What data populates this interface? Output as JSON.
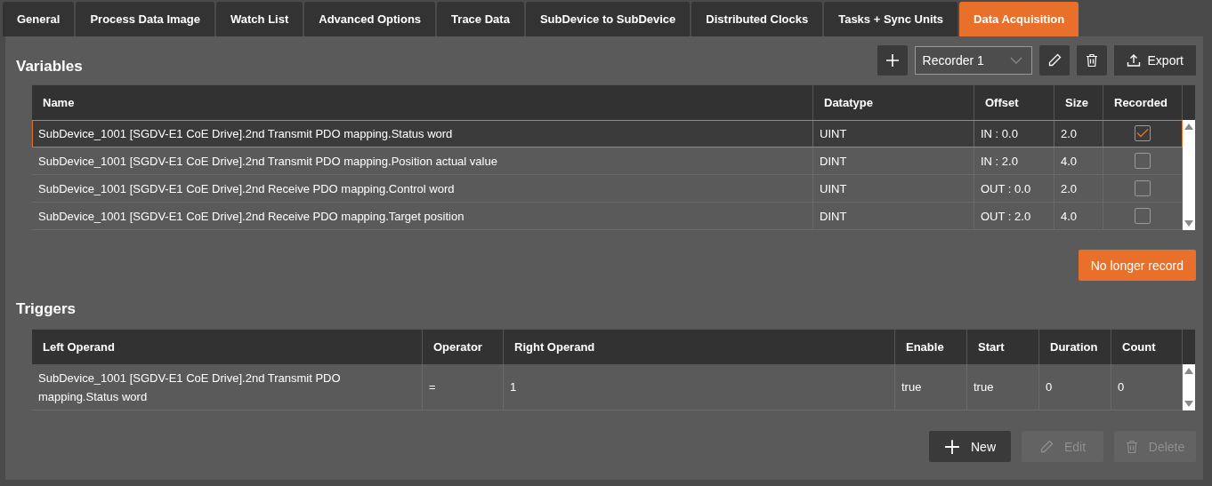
{
  "tabs": [
    {
      "label": "General",
      "selected": false
    },
    {
      "label": "Process Data Image",
      "selected": false
    },
    {
      "label": "Watch List",
      "selected": false
    },
    {
      "label": "Advanced Options",
      "selected": false
    },
    {
      "label": "Trace Data",
      "selected": false
    },
    {
      "label": "SubDevice to SubDevice",
      "selected": false
    },
    {
      "label": "Distributed Clocks",
      "selected": false
    },
    {
      "label": "Tasks + Sync Units",
      "selected": false
    },
    {
      "label": "Data Acquisition",
      "selected": true
    }
  ],
  "variables": {
    "title": "Variables",
    "recorder": {
      "value": "Recorder 1"
    },
    "export_button": "Export",
    "columns": [
      "Name",
      "Datatype",
      "Offset",
      "Size",
      "Recorded"
    ],
    "rows": [
      {
        "name": "SubDevice_1001 [SGDV-E1 CoE Drive].2nd Transmit PDO mapping.Status word",
        "datatype": "UINT",
        "offset": "IN : 0.0",
        "size": "2.0",
        "recorded": true,
        "selected": true
      },
      {
        "name": "SubDevice_1001 [SGDV-E1 CoE Drive].2nd Transmit PDO mapping.Position actual value",
        "datatype": "DINT",
        "offset": "IN : 2.0",
        "size": "4.0",
        "recorded": false,
        "selected": false
      },
      {
        "name": "SubDevice_1001 [SGDV-E1 CoE Drive].2nd Receive PDO mapping.Control word",
        "datatype": "UINT",
        "offset": "OUT : 0.0",
        "size": "2.0",
        "recorded": false,
        "selected": false
      },
      {
        "name": "SubDevice_1001 [SGDV-E1 CoE Drive].2nd Receive PDO mapping.Target position",
        "datatype": "DINT",
        "offset": "OUT : 2.0",
        "size": "4.0",
        "recorded": false,
        "selected": false
      }
    ],
    "record_button": "No longer record"
  },
  "triggers": {
    "title": "Triggers",
    "columns": [
      "Left Operand",
      "Operator",
      "Right Operand",
      "Enable",
      "Start",
      "Duration",
      "Count"
    ],
    "rows": [
      {
        "cells": [
          "SubDevice_1001 [SGDV-E1 CoE Drive].2nd Transmit PDO mapping.Status word",
          "=",
          "1",
          "true",
          "true",
          "0",
          "0"
        ]
      }
    ],
    "buttons": [
      {
        "label": "New",
        "kind": "new",
        "disabled": false
      },
      {
        "label": "Edit",
        "kind": "edit",
        "disabled": true
      },
      {
        "label": "Delete",
        "kind": "delete",
        "disabled": true
      }
    ]
  }
}
